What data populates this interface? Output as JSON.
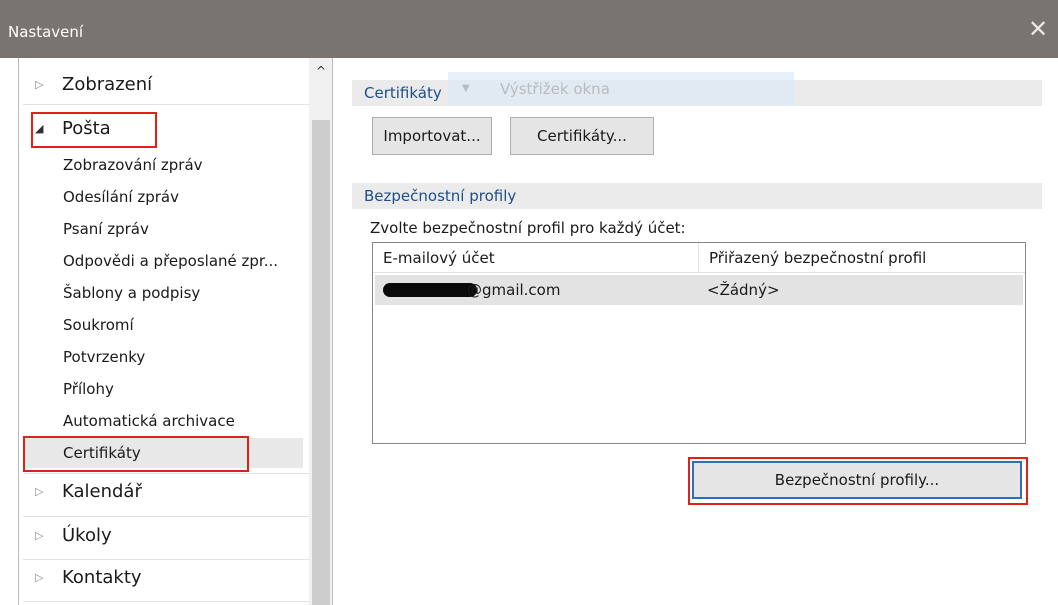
{
  "window": {
    "title": "Nastavení",
    "close_glyph": "✕"
  },
  "tree": {
    "items": [
      {
        "label": "Zobrazení",
        "arrow": "▷"
      },
      {
        "label": "Pošta",
        "arrow": "◢"
      },
      {
        "label": "Kalendář",
        "arrow": "▷"
      },
      {
        "label": "Úkoly",
        "arrow": "▷"
      },
      {
        "label": "Kontakty",
        "arrow": "▷"
      }
    ],
    "mail_children": [
      "Zobrazování zpráv",
      "Odesílání zpráv",
      "Psaní zpráv",
      "Odpovědi a přeposlané zpr...",
      "Šablony a podpisy",
      "Soukromí",
      "Potvrzenky",
      "Přílohy",
      "Automatická archivace",
      "Certifikáty"
    ],
    "selected": "Certifikáty",
    "scroll_up_glyph": "^"
  },
  "ghost": {
    "glyph": "▼",
    "label": "Výstřižek okna"
  },
  "certificates": {
    "header": "Certifikáty",
    "import_button": "Importovat...",
    "certificates_button": "Certifikáty..."
  },
  "security": {
    "header": "Bezpečnostní profily",
    "prompt": "Zvolte bezpečnostní profil pro každý účet:",
    "columns": [
      "E-mailový účet",
      "Přiřazený bezpečnostní profil"
    ],
    "rows": [
      {
        "account_suffix": "@gmail.com",
        "profile": "<Žádný>"
      }
    ],
    "profiles_button": "Bezpečnostní profily..."
  },
  "colors": {
    "highlight": "#e0201b",
    "titlebar": "#7a7470",
    "header_text": "#1f4e8a"
  }
}
